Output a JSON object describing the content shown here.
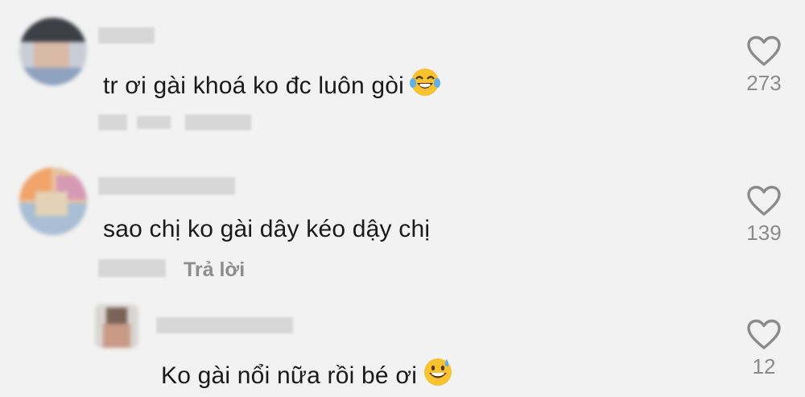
{
  "comments": [
    {
      "text": "tr ơi gài khoá ko đc luôn gòi",
      "emoji": "tears-of-joy-emoji",
      "likes": "273"
    },
    {
      "text": "sao chị ko gài dây kéo dậy chị",
      "reply_label": "Trả lời",
      "likes": "139"
    },
    {
      "text": "Ko gài nổi nữa rồi bé ơi",
      "emoji": "grinning-sweat-emoji",
      "likes": "12"
    }
  ],
  "colors": {
    "background": "#f2f2f2",
    "text": "#1a1a1a",
    "muted": "#8d8d8d",
    "blurred_placeholder": "#d7d7d7",
    "emoji_face": "#f7c331"
  },
  "icons": {
    "like": "heart-outline-icon"
  }
}
